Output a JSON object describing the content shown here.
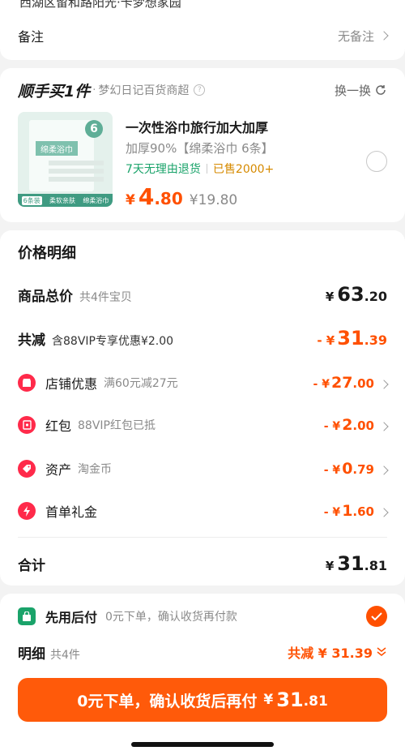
{
  "top_address": "西湖区留和路阳光·卡梦想家园",
  "remark": {
    "label": "备注",
    "value": "无备注"
  },
  "shunshou": {
    "brand": "顺手买1件",
    "shop": "梦幻日记百货商超",
    "swap": "换一换",
    "product": {
      "title": "一次性浴巾旅行加大加厚",
      "spec": "加厚90%【绵柔浴巾 6条】",
      "return_policy": "7天无理由退货",
      "sold": "已售2000+",
      "price_symbol": "¥",
      "price_int": "4",
      "price_dec": ".80",
      "orig_price": "¥19.80",
      "thumb_title": "绵柔浴巾",
      "thumb_count": "6",
      "thumb_tag1": "6条装",
      "thumb_tag2": "柔软亲肤",
      "thumb_tag3": "绵柔浴巾"
    }
  },
  "price_detail": {
    "heading": "价格明细",
    "total": {
      "label": "商品总价",
      "sub": "共4件宝贝",
      "symbol": "¥",
      "int": "63",
      "dec": ".20"
    },
    "discount": {
      "label": "共减",
      "sub": "含88VIP专享优惠¥2.00",
      "prefix": "- ¥",
      "int": "31",
      "dec": ".39"
    },
    "items": [
      {
        "label": "店铺优惠",
        "sub": "满60元减27元",
        "prefix": "- ¥",
        "int": "27",
        "dec": ".00"
      },
      {
        "label": "红包",
        "sub": "88VIP红包已抵",
        "prefix": "- ¥",
        "int": "2",
        "dec": ".00"
      },
      {
        "label": "资产",
        "sub": "淘金币",
        "prefix": "- ¥",
        "int": "0",
        "dec": ".79"
      },
      {
        "label": "首单礼金",
        "sub": "",
        "prefix": "- ¥",
        "int": "1",
        "dec": ".60"
      }
    ],
    "sum": {
      "label": "合计",
      "symbol": "¥",
      "int": "31",
      "dec": ".81"
    }
  },
  "pay_later": {
    "label": "先用后付",
    "sub": "0元下单，确认收货再付款"
  },
  "detail": {
    "label": "明细",
    "sub": "共4件",
    "saving": "共减 ¥ 31.39"
  },
  "cta": {
    "text": "0元下单，确认收货后再付",
    "symbol": "¥",
    "int": "31",
    "dec": ".81"
  },
  "colors": {
    "accent": "#ff5000",
    "red": "#ff2a4a",
    "green": "#1aa36a"
  }
}
